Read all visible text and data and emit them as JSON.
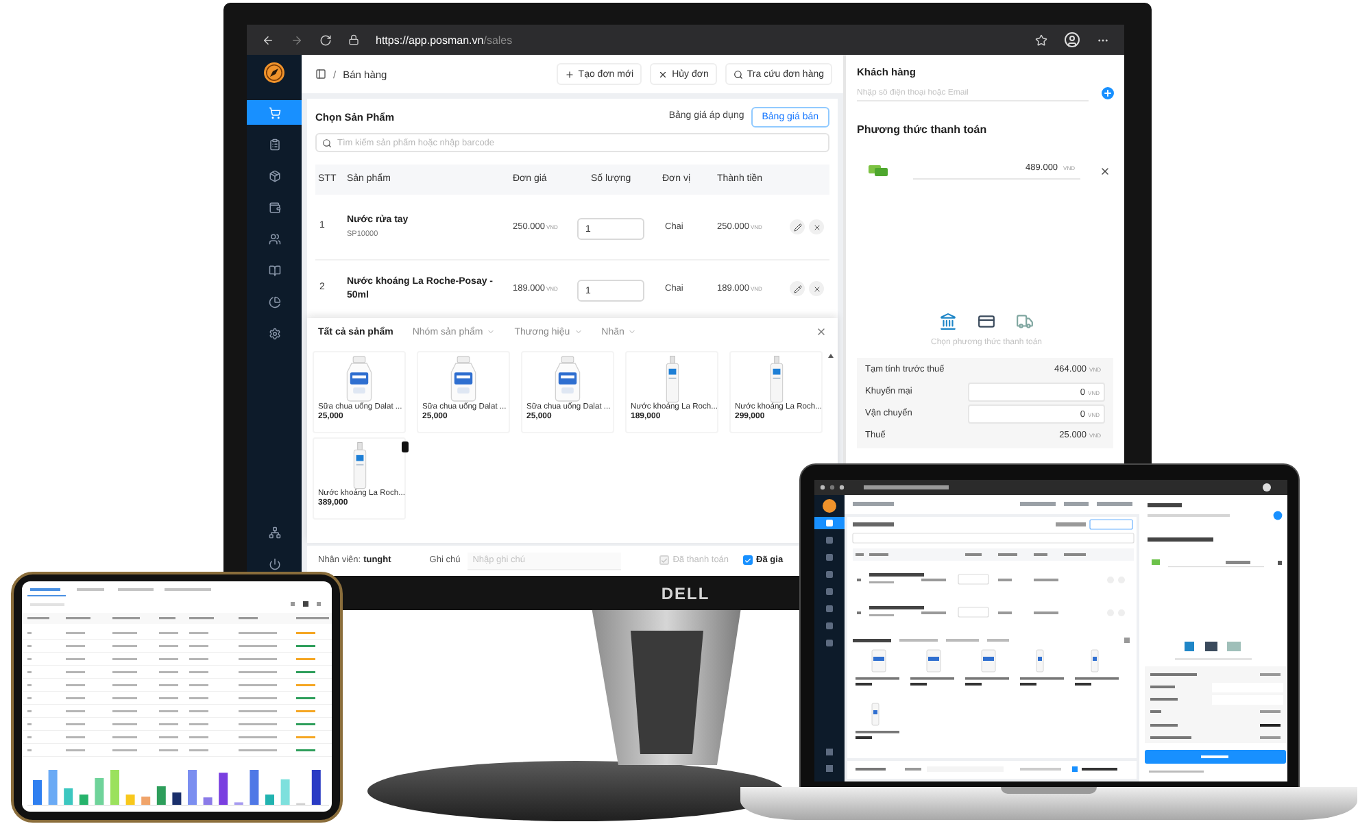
{
  "browser": {
    "url_base": "https://app.posman.vn",
    "url_path": "/sales"
  },
  "sidebar": {
    "items": [
      {
        "selected": true
      },
      {
        "selected": false
      },
      {
        "selected": false
      },
      {
        "selected": false
      },
      {
        "selected": false
      },
      {
        "selected": false
      },
      {
        "selected": false
      },
      {
        "selected": false
      }
    ]
  },
  "header": {
    "separator": "/",
    "title": "Bán hàng",
    "actions": [
      {
        "kind": "create",
        "label": "Tạo đơn mới"
      },
      {
        "kind": "cancel",
        "label": "Hủy đơn"
      },
      {
        "kind": "search",
        "label": "Tra cứu đơn hàng"
      }
    ]
  },
  "picker": {
    "title": "Chọn Sản Phẩm",
    "price_list_label": "Bảng giá áp dụng",
    "price_list_button": "Bảng giá bán",
    "search_placeholder": "Tìm kiếm sản phẩm hoặc nhập barcode"
  },
  "cart": {
    "columns": [
      "STT",
      "Sản phẩm",
      "Đơn giá",
      "Số lượng",
      "Đơn vị",
      "Thành tiền"
    ],
    "rows": [
      {
        "no": "1",
        "name": "Nước rửa tay",
        "code": "SP10000",
        "price": "250.000",
        "price_currency": "VND",
        "quantity": "1",
        "unit": "Chai",
        "total": "250.000",
        "total_currency": "VND"
      },
      {
        "no": "2",
        "name": "Nước khoáng La Roche-Posay - 50ml",
        "price": "189.000",
        "price_currency": "VND",
        "quantity": "1",
        "unit": "Chai",
        "total": "189.000",
        "total_currency": "VND"
      }
    ]
  },
  "catalog": {
    "tabs": [
      {
        "label": "Tất cả sản phẩm",
        "selected": true,
        "dropdown": false
      },
      {
        "label": "Nhóm sản phẩm",
        "selected": false,
        "dropdown": true
      },
      {
        "label": "Thương hiệu",
        "selected": false,
        "dropdown": true
      },
      {
        "label": "Nhãn",
        "selected": false,
        "dropdown": true
      }
    ],
    "products": [
      {
        "kind": "yogurt",
        "name": "Sữa chua uống Dalat ...",
        "price": "25,000",
        "badge": false
      },
      {
        "kind": "yogurt",
        "name": "Sữa chua uống Dalat ...",
        "price": "25,000",
        "badge": false
      },
      {
        "kind": "yogurt",
        "name": "Sữa chua uống Dalat ...",
        "price": "25,000",
        "badge": false
      },
      {
        "kind": "water",
        "name": "Nước khoáng La Roch...",
        "price": "189,000",
        "badge": false
      },
      {
        "kind": "water",
        "name": "Nước khoáng La Roch...",
        "price": "299,000",
        "badge": false
      },
      {
        "kind": "water",
        "name": "Nước khoáng La Roch...",
        "price": "389,000",
        "badge": true
      }
    ]
  },
  "footer": {
    "staff_label": "Nhân viên:",
    "staff_name": "tunght",
    "note_label": "Ghi chú",
    "note_placeholder": "Nhập ghi chú",
    "checks": [
      {
        "label": "Đã thanh toán",
        "checked": true,
        "disabled": true
      },
      {
        "label": "Đã gia",
        "checked": true,
        "disabled": false
      }
    ]
  },
  "customer": {
    "title": "Khách hàng",
    "placeholder": "Nhập số điện thoại hoặc Email"
  },
  "payment": {
    "title": "Phương thức thanh toán",
    "entries": [
      {
        "kind": "cash",
        "amount": "489.000",
        "currency": "VND"
      }
    ],
    "hint": "Chọn phương thức thanh toán"
  },
  "summary": {
    "rows": [
      {
        "kind": "text",
        "label": "Tạm tính trước thuế",
        "value": "464.000",
        "currency": "VND"
      },
      {
        "kind": "input",
        "label": "Khuyến mại",
        "value": "0",
        "currency": "VND"
      },
      {
        "kind": "input",
        "label": "Vận chuyển",
        "value": "0",
        "currency": "VND"
      },
      {
        "kind": "text",
        "label": "Thuế",
        "value": "25.000",
        "currency": "VND"
      }
    ]
  },
  "monitor": {
    "logo": "DELL"
  }
}
